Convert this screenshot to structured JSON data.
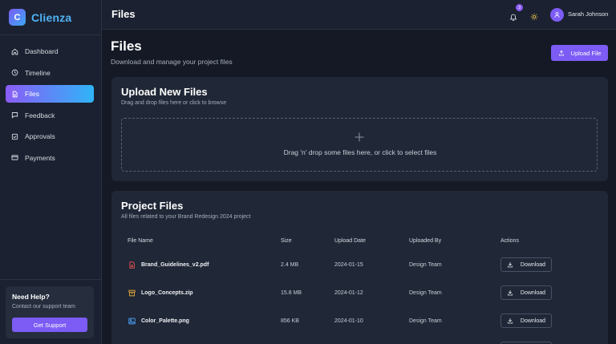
{
  "brand": {
    "logo_letter": "C",
    "name": "Clienza"
  },
  "sidebar": {
    "items": [
      {
        "label": "Dashboard",
        "icon": "home-icon",
        "active": false
      },
      {
        "label": "Timeline",
        "icon": "clock-icon",
        "active": false
      },
      {
        "label": "Files",
        "icon": "file-icon",
        "active": true
      },
      {
        "label": "Feedback",
        "icon": "message-icon",
        "active": false
      },
      {
        "label": "Approvals",
        "icon": "check-square-icon",
        "active": false
      },
      {
        "label": "Payments",
        "icon": "credit-card-icon",
        "active": false
      }
    ],
    "help": {
      "title": "Need Help?",
      "subtitle": "Contact our support team",
      "button": "Get Support"
    }
  },
  "header": {
    "title": "Files",
    "notification_count": "3",
    "user_name": "Sarah Johnson"
  },
  "main": {
    "title": "Files",
    "subtitle": "Download and manage your project files",
    "upload_button": "Upload File",
    "upload_card": {
      "title": "Upload New Files",
      "subtitle": "Drag and drop files here or click to browse",
      "dropzone_text": "Drag 'n' drop some files here, or click to select files"
    },
    "files_card": {
      "title": "Project Files",
      "subtitle": "All files related to your Brand Redesign 2024 project",
      "columns": [
        "File Name",
        "Size",
        "Upload Date",
        "Uploaded By",
        "Actions"
      ],
      "rows": [
        {
          "name": "Brand_Guidelines_v2.pdf",
          "size": "2.4 MB",
          "date": "2024-01-15",
          "by": "Design Team",
          "action": "Download",
          "icon": "pdf-file-icon",
          "icon_color": "#e05252"
        },
        {
          "name": "Logo_Concepts.zip",
          "size": "15.8 MB",
          "date": "2024-01-12",
          "by": "Design Team",
          "action": "Download",
          "icon": "archive-icon",
          "icon_color": "#e0a93a"
        },
        {
          "name": "Color_Palette.png",
          "size": "856 KB",
          "date": "2024-01-10",
          "by": "Design Team",
          "action": "Download",
          "icon": "image-icon",
          "icon_color": "#4a9ef5"
        }
      ]
    }
  },
  "colors": {
    "accent": "#7c5cf5",
    "brand": "#4fb4f6",
    "background": "#141925",
    "surface": "#202736"
  }
}
